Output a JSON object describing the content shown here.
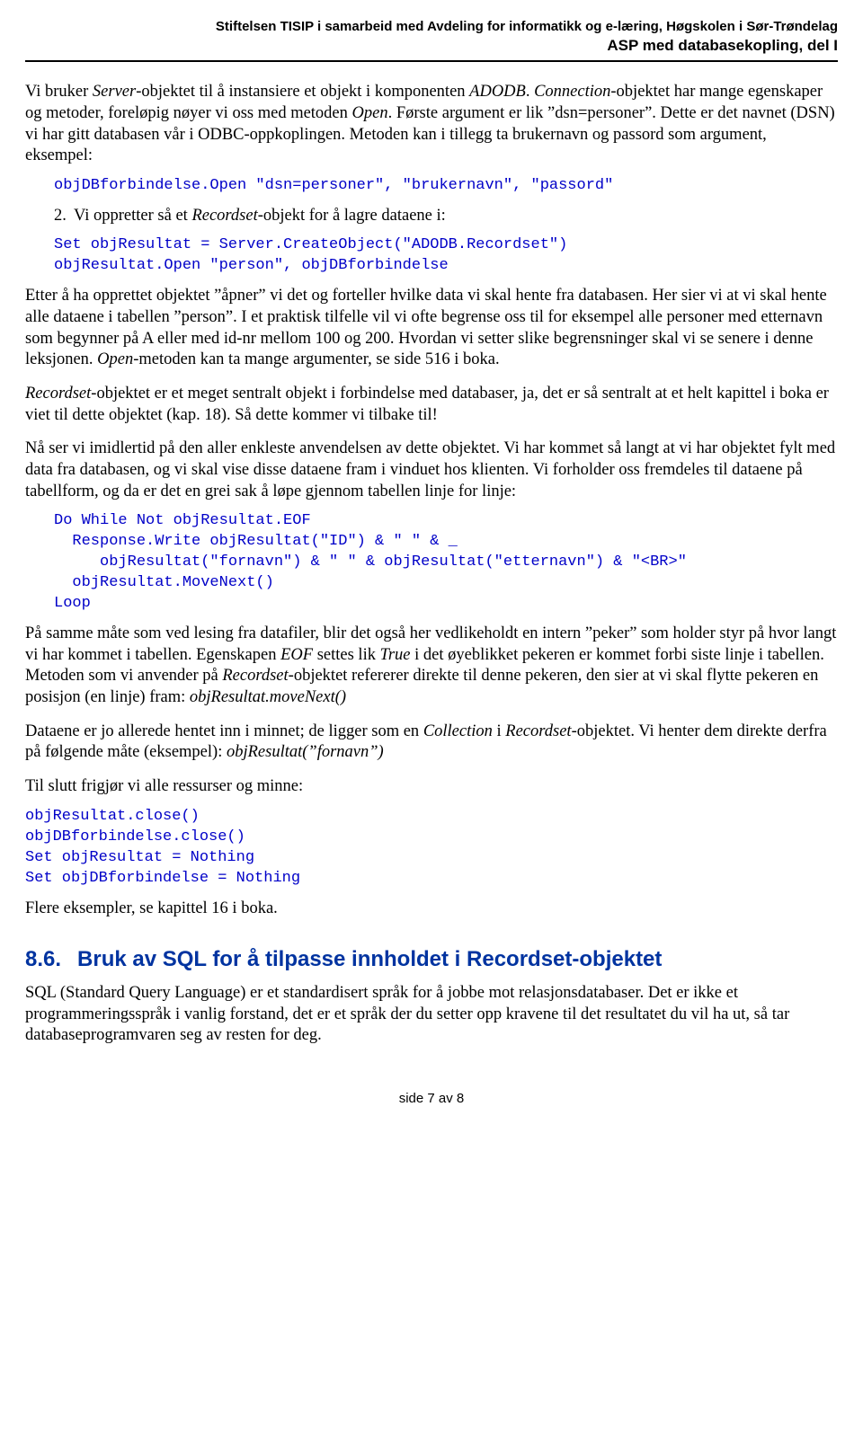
{
  "header": {
    "line1": "Stiftelsen TISIP i samarbeid med Avdeling for informatikk og e-læring, Høgskolen i Sør-Trøndelag",
    "line2": "ASP med databasekopling, del I"
  },
  "p1": {
    "a": "Vi bruker ",
    "b": "Server",
    "c": "-objektet til å instansiere et objekt i komponenten ",
    "d": "ADODB",
    "e": ". ",
    "f": "Connection",
    "g": "-objektet har mange egenskaper og metoder, foreløpig nøyer vi oss med metoden ",
    "h": "Open",
    "i": ". Første argument er lik ”dsn=personer”. Dette er det navnet (DSN) vi har gitt databasen vår i ODBC-oppkoplingen. Metoden kan i tillegg ta brukernavn og passord som argument, eksempel:"
  },
  "code1": "objDBforbindelse.Open \"dsn=personer\", \"brukernavn\", \"passord\"",
  "li2": {
    "num": "2.",
    "a": "Vi oppretter så et ",
    "b": "Recordset",
    "c": "-objekt for å lagre dataene i:"
  },
  "code2": "Set objResultat = Server.CreateObject(\"ADODB.Recordset\")\nobjResultat.Open \"person\", objDBforbindelse",
  "p2": {
    "a": "Etter å ha opprettet objektet ”åpner” vi det og forteller hvilke data vi skal hente fra databasen. Her sier vi at vi skal hente alle dataene i tabellen ”person”. I et praktisk tilfelle vil vi ofte begrense oss til for eksempel alle personer med etternavn som begynner på A eller med id-nr mellom 100 og 200. Hvordan vi setter slike begrensninger skal vi se senere i denne leksjonen. ",
    "b": "Open",
    "c": "-metoden kan ta mange argumenter, se side 516 i boka."
  },
  "p3": {
    "a": "Recordset",
    "b": "-objektet er et meget sentralt objekt i forbindelse med databaser, ja, det er så sentralt at et helt kapittel i boka er viet til dette objektet (kap. 18). Så dette kommer vi tilbake til!"
  },
  "p4": "Nå ser vi imidlertid på den aller enkleste anvendelsen av dette objektet. Vi har kommet så langt at vi har objektet fylt med data fra databasen, og vi skal vise disse dataene fram i vinduet hos klienten. Vi forholder oss fremdeles til dataene på tabellform, og da er det en grei sak å løpe gjennom tabellen linje for linje:",
  "code3": "Do While Not objResultat.EOF\n  Response.Write objResultat(\"ID\") & \" \" & _\n     objResultat(\"fornavn\") & \" \" & objResultat(\"etternavn\") & \"<BR>\"\n  objResultat.MoveNext()\nLoop",
  "p5": {
    "a": "På samme måte som ved lesing fra datafiler, blir det også her vedlikeholdt en intern ”peker” som holder styr på hvor langt vi har kommet i tabellen. Egenskapen ",
    "b": "EOF",
    "c": " settes lik ",
    "d": "True",
    "e": " i det øyeblikket pekeren er kommet forbi siste linje i tabellen. Metoden som vi anvender på ",
    "f": "Recordset",
    "g": "-objektet refererer direkte til denne pekeren, den sier at vi skal flytte pekeren en posisjon (en linje) fram: ",
    "h": "objResultat.moveNext()"
  },
  "p6": {
    "a": "Dataene er jo allerede hentet inn i minnet; de ligger som en ",
    "b": "Collection",
    "c": " i ",
    "d": "Recordset",
    "e": "-objektet. Vi henter dem direkte derfra på følgende måte (eksempel): ",
    "f": "objResultat(”fornavn”)"
  },
  "p7": "Til slutt frigjør vi alle ressurser og minne:",
  "code4": "objResultat.close()\nobjDBforbindelse.close()\nSet objResultat = Nothing\nSet objDBforbindelse = Nothing",
  "p8": "Flere eksempler, se kapittel 16 i boka.",
  "section": {
    "num": "8.6.",
    "title": "Bruk av SQL for å tilpasse innholdet i Recordset-objektet"
  },
  "p9": "SQL (Standard Query Language) er et standardisert språk for å jobbe mot relasjonsdatabaser. Det er ikke et programmeringsspråk i vanlig forstand, det er et språk der du setter opp kravene til det resultatet du vil ha ut, så tar databaseprogramvaren seg av resten for deg.",
  "footer": "side 7 av 8"
}
